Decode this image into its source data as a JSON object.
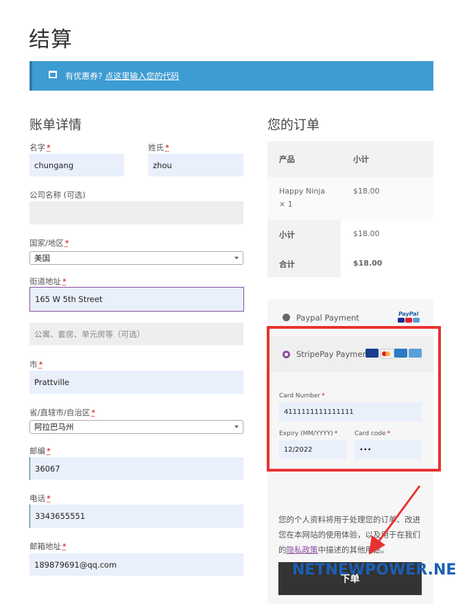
{
  "page": {
    "title": "结算"
  },
  "coupon": {
    "prefix": "有优惠券?",
    "link": "点这里输入您的代码",
    "icon": "window-icon"
  },
  "billing": {
    "heading": "账单详情",
    "first_name": {
      "label": "名字",
      "required": "*",
      "value": "chungang"
    },
    "last_name": {
      "label": "姓氏",
      "required": "*",
      "value": "zhou"
    },
    "company": {
      "label": "公司名称 (可选)",
      "value": ""
    },
    "country": {
      "label": "国家/地区",
      "required": "*",
      "value": "美国"
    },
    "street": {
      "label": "街道地址",
      "required": "*",
      "value": "165 W 5th Street",
      "placeholder2": "公寓、套房、单元房等（可选）"
    },
    "city": {
      "label": "市",
      "required": "*",
      "value": "Prattville"
    },
    "state": {
      "label": "省/直辖市/自治区",
      "required": "*",
      "value": "阿拉巴马州"
    },
    "postcode": {
      "label": "邮编",
      "required": "*",
      "value": "36067"
    },
    "phone": {
      "label": "电话",
      "required": "*",
      "value": "3343655551"
    },
    "email": {
      "label": "邮箱地址",
      "required": "*",
      "value": "189879691@qq.com"
    }
  },
  "order": {
    "heading": "您的订单",
    "col_product": "产品",
    "col_subtotal": "小计",
    "item_name": "Happy Ninja",
    "item_qty": "× 1",
    "item_price": "$18.00",
    "subtotal_label": "小计",
    "subtotal_value": "$18.00",
    "total_label": "合计",
    "total_value": "$18.00"
  },
  "payment": {
    "paypal_label": "Paypal Payment",
    "paypal_badge": "PayPal",
    "stripe_label": "StripePay Payment",
    "card_number_label": "Card Number",
    "card_number_value": "4111111111111111",
    "expiry_label": "Expiry (MM/YYYY)",
    "expiry_value": "12/2022",
    "cvc_label": "Card code",
    "cvc_value": "•••",
    "required": "*",
    "privacy_text_1": "您的个人资料将用于处理您的订单、改进您在本网站的使用体验，以及用于在我们的",
    "privacy_link": "隐私政策",
    "privacy_text_2": "中描述的其他用途。",
    "place_order": "下单",
    "watermark": "NETNEWPOWER.NET",
    "colors": {
      "highlight": "#e8322f",
      "accent": "#8a4a9e"
    }
  }
}
